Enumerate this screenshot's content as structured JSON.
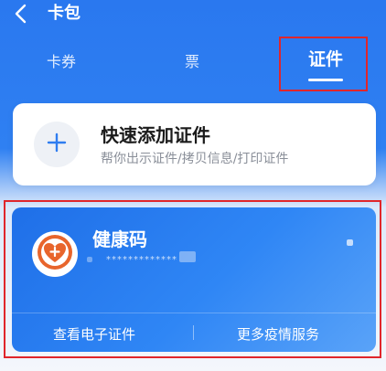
{
  "header": {
    "title": "卡包"
  },
  "tabs": [
    {
      "label": "卡券",
      "selected": false
    },
    {
      "label": "票",
      "selected": false
    },
    {
      "label": "证件",
      "selected": true
    }
  ],
  "quick_add": {
    "title": "快速添加证件",
    "subtitle": "帮你出示证件/拷贝信息/打印证件"
  },
  "health_card": {
    "title": "健康码",
    "masked_id": "*************",
    "actions": [
      {
        "label": "查看电子证件"
      },
      {
        "label": "更多疫情服务"
      }
    ]
  },
  "colors": {
    "primary_blue": "#2f7df0",
    "highlight_red": "#e0262b",
    "logo_orange": "#e8652c"
  },
  "icons": [
    "back-arrow-icon",
    "plus-icon",
    "health-heart-icon"
  ]
}
